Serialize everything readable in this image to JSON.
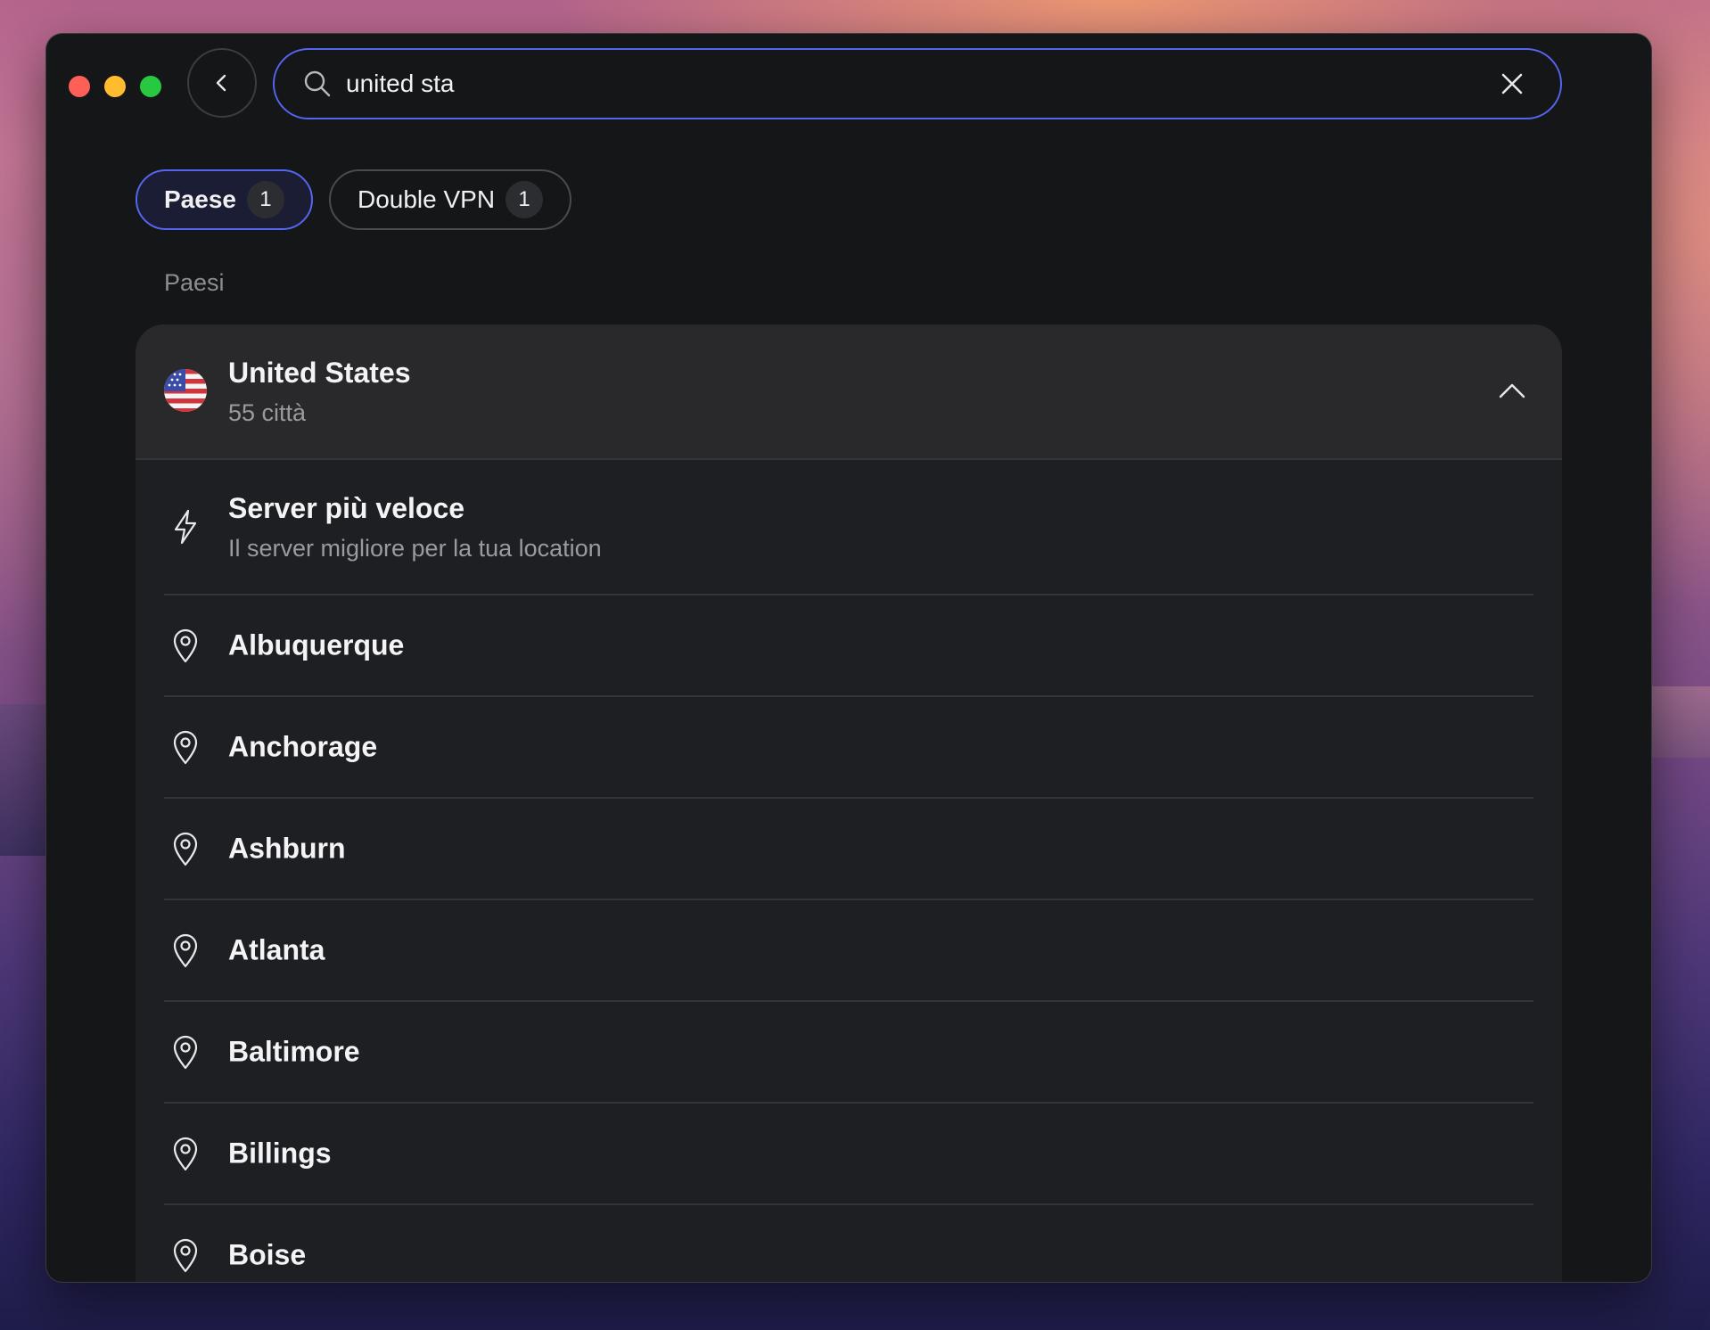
{
  "window": {
    "accent": "#5565f0"
  },
  "search": {
    "value": "united sta",
    "placeholder": ""
  },
  "filters": [
    {
      "label": "Paese",
      "count": "1",
      "active": true
    },
    {
      "label": "Double VPN",
      "count": "1",
      "active": false
    }
  ],
  "section_title": "Paesi",
  "country": {
    "name": "United States",
    "subtitle": "55 città",
    "flag": "us-flag-icon"
  },
  "fastest": {
    "title": "Server più veloce",
    "subtitle": "Il server migliore per la tua location"
  },
  "cities": [
    "Albuquerque",
    "Anchorage",
    "Ashburn",
    "Atlanta",
    "Baltimore",
    "Billings",
    "Boise"
  ]
}
